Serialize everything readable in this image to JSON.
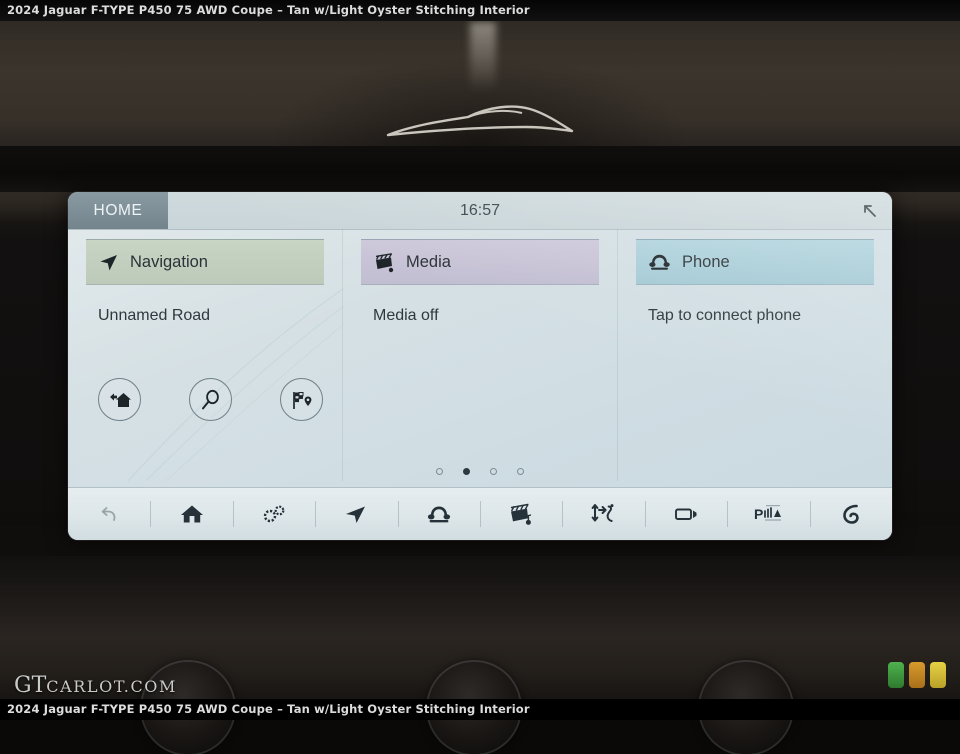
{
  "caption": {
    "top": "2024 Jaguar F-TYPE P450 75 AWD Coupe – Tan w/Light Oyster Stitching Interior",
    "bottom": "2024 Jaguar F-TYPE P450 75 AWD Coupe – Tan w/Light Oyster Stitching Interior"
  },
  "watermark": {
    "primary": "GT",
    "secondary": "CARLOT.COM"
  },
  "chips": [
    {
      "name": "chip-green",
      "color": "#3f9a3f"
    },
    {
      "name": "chip-orange",
      "color": "#c98a24"
    },
    {
      "name": "chip-yellow",
      "color": "#d8c236"
    }
  ],
  "screen": {
    "topbar": {
      "tab_label": "HOME",
      "clock": "16:57",
      "collapse_icon": "collapse-arrow-icon"
    },
    "panels": [
      {
        "key": "navigation",
        "icon": "navigation-arrow-icon",
        "title": "Navigation",
        "subtitle": "Unnamed Road",
        "header_color": "#c8d4c4"
      },
      {
        "key": "media",
        "icon": "media-clapper-icon",
        "title": "Media",
        "subtitle": "Media off",
        "header_color": "#cdc8da"
      },
      {
        "key": "phone",
        "icon": "telephone-icon",
        "title": "Phone",
        "subtitle": "Tap to connect phone",
        "header_color": "#b0d3dd"
      }
    ],
    "quick_actions": [
      {
        "name": "navigate-home-button",
        "icon": "home-route-icon"
      },
      {
        "name": "search-destination-button",
        "icon": "magnifier-icon"
      },
      {
        "name": "recent-destinations-button",
        "icon": "checkered-flag-pin-icon"
      }
    ],
    "pager": {
      "total": 4,
      "active_index": 1
    },
    "toolbar": [
      {
        "name": "back-button",
        "icon": "back-arrow-icon",
        "dim": true
      },
      {
        "name": "home-button",
        "icon": "house-icon",
        "dim": false
      },
      {
        "name": "settings-button",
        "icon": "gears-icon",
        "dim": false
      },
      {
        "name": "navigation-button",
        "icon": "navigation-arrow-icon",
        "dim": false
      },
      {
        "name": "phone-button",
        "icon": "telephone-icon",
        "dim": false
      },
      {
        "name": "media-button",
        "icon": "media-clapper-icon",
        "dim": false
      },
      {
        "name": "climate-seat-button",
        "icon": "climate-seat-icon",
        "dim": false
      },
      {
        "name": "camera-button",
        "icon": "camera-view-icon",
        "dim": false
      },
      {
        "name": "park-assist-button",
        "icon": "park-assist-icon",
        "dim": false
      },
      {
        "name": "valet-audio-button",
        "icon": "headrest-audio-icon",
        "dim": false
      }
    ]
  }
}
